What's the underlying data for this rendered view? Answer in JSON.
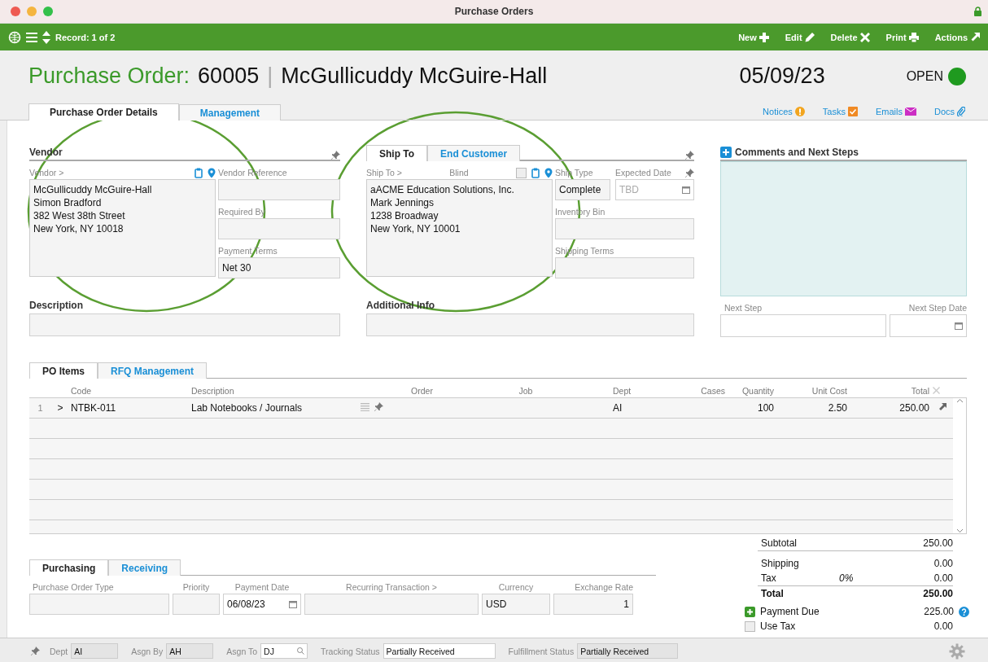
{
  "window": {
    "title": "Purchase Orders"
  },
  "toolbar": {
    "record": "Record: 1 of 2",
    "actions": [
      {
        "label": "New",
        "kind": "new"
      },
      {
        "label": "Edit",
        "kind": "edit"
      },
      {
        "label": "Delete",
        "kind": "delete"
      },
      {
        "label": "Print",
        "kind": "print"
      },
      {
        "label": "Actions",
        "kind": "actions"
      }
    ]
  },
  "header": {
    "label": "Purchase Order:",
    "number": "60005",
    "separator": "|",
    "vendor": "McGullicuddy McGuire-Hall",
    "date": "05/09/23",
    "status": "OPEN"
  },
  "tabs": [
    {
      "label": "Purchase Order Details",
      "selected": true
    },
    {
      "label": "Management",
      "selected": false
    }
  ],
  "links": [
    {
      "label": "Notices",
      "kind": "notices"
    },
    {
      "label": "Tasks",
      "kind": "tasks"
    },
    {
      "label": "Emails",
      "kind": "emails"
    },
    {
      "label": "Docs",
      "kind": "docs"
    }
  ],
  "vendor": {
    "title": "Vendor",
    "field_label": "Vendor >",
    "address": [
      "McGullicuddy McGuire-Hall",
      "Simon Bradford",
      "382 West 38th Street",
      "New York, NY 10018"
    ],
    "fields": [
      {
        "label": "Vendor Reference"
      },
      {
        "label": "Required By"
      },
      {
        "label": "Payment Terms",
        "value": "Net 30"
      }
    ]
  },
  "ship": {
    "tabs": [
      {
        "label": "Ship To",
        "selected": true
      },
      {
        "label": "End Customer",
        "selected": false
      }
    ],
    "field_label": "Ship To >",
    "blind": {
      "label": "Blind",
      "checked": false
    },
    "address": [
      "aACME Education Solutions, Inc.",
      "Mark Jennings",
      "1238 Broadway",
      "New York, NY 10001"
    ],
    "ship_type": {
      "label": "Ship Type",
      "value": "Complete"
    },
    "expected_date": {
      "label": "Expected Date",
      "placeholder": "TBD"
    },
    "fields": [
      {
        "label": "Inventory Bin"
      },
      {
        "label": "Shipping Terms"
      }
    ]
  },
  "description": {
    "label": "Description"
  },
  "additional_info": {
    "label": "Additional Info"
  },
  "comments": {
    "title": "Comments and Next Steps",
    "next_step": {
      "label": "Next Step"
    },
    "next_step_date": {
      "label": "Next Step Date"
    }
  },
  "items": {
    "tabs": [
      {
        "label": "PO Items",
        "selected": true
      },
      {
        "label": "RFQ Management",
        "selected": false
      }
    ],
    "columns": [
      "Code",
      "Description",
      "Order",
      "Job",
      "Dept",
      "Cases",
      "Quantity",
      "Unit Cost",
      "Total"
    ],
    "rows": [
      {
        "number": "1",
        "expander": ">",
        "code": "NTBK-011",
        "description": "Lab Notebooks / Journals",
        "dept": "AI",
        "quantity": "100",
        "unit_cost": "2.50",
        "total": "250.00"
      }
    ]
  },
  "purchasing": {
    "tabs": [
      {
        "label": "Purchasing",
        "selected": true
      },
      {
        "label": "Receiving",
        "selected": false
      }
    ],
    "fields": [
      {
        "label": "Purchase Order Type"
      },
      {
        "label": "Priority"
      },
      {
        "label": "Payment Date",
        "value": "06/08/23",
        "kind": "date"
      },
      {
        "label": "Recurring Transaction >"
      },
      {
        "label": "Currency",
        "value": "USD"
      },
      {
        "label": "Exchange Rate",
        "value": "1",
        "kind": "number"
      }
    ]
  },
  "totals": [
    {
      "label": "Subtotal",
      "value": "250.00",
      "kind": "line"
    },
    {
      "label": "Shipping",
      "value": "0.00",
      "kind": "line"
    },
    {
      "label": "Tax",
      "rate": "0%",
      "value": "0.00",
      "kind": "line"
    },
    {
      "label": "Total",
      "value": "250.00",
      "kind": "total"
    },
    {
      "label": "Payment Due",
      "value": "225.00",
      "kind": "due"
    },
    {
      "label": "Use Tax",
      "value": "0.00",
      "kind": "check",
      "checked": false
    }
  ],
  "status_bar": {
    "fields": [
      {
        "label": "Dept",
        "value": "AI",
        "editable": false
      },
      {
        "label": "Asgn By",
        "value": "AH",
        "editable": false
      },
      {
        "label": "Asgn To",
        "value": "DJ",
        "editable": true,
        "kind": "search"
      },
      {
        "label": "Tracking Status",
        "value": "Partially Received",
        "editable": true
      },
      {
        "label": "Fulfillment Status",
        "value": "Partially Received",
        "editable": false
      }
    ]
  },
  "annotation_circles": [
    {
      "kind": "ellipse"
    },
    {
      "kind": "ellipse"
    }
  ]
}
